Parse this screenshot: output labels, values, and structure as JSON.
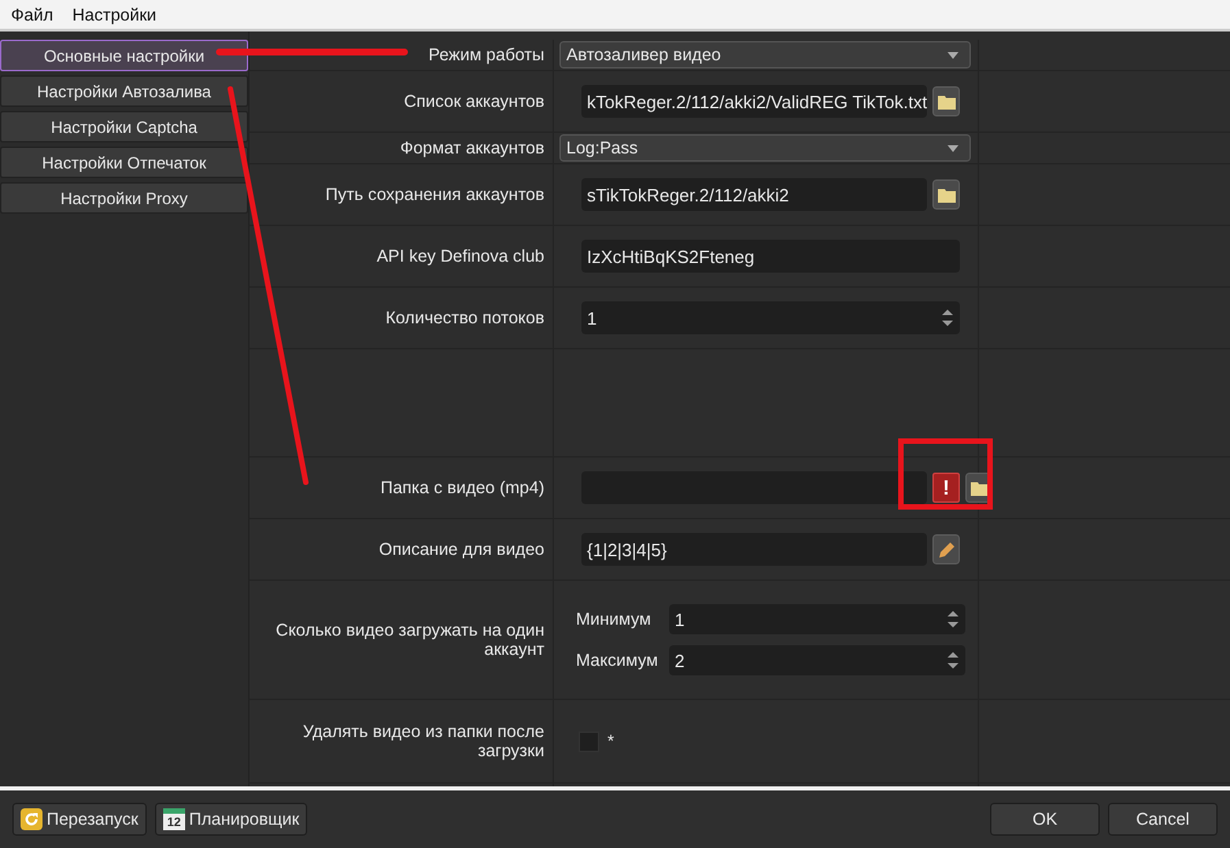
{
  "menu": [
    "Файл",
    "Настройки"
  ],
  "sidebar": {
    "items": [
      {
        "label": "Основные настройки",
        "selected": true
      },
      {
        "label": "Настройки Автозалива",
        "selected": false
      },
      {
        "label": "Настройки Captcha",
        "selected": false
      },
      {
        "label": "Настройки Отпечаток",
        "selected": false
      },
      {
        "label": "Настройки Proxy",
        "selected": false
      }
    ]
  },
  "form": {
    "rows": [
      {
        "kind": "combo",
        "label": "Режим работы",
        "value": "Автозаливер видео"
      },
      {
        "kind": "file",
        "label": "Список аккаунтов",
        "value": "kTokReger.2/112/akki2/ValidREG TikTok.txt"
      },
      {
        "kind": "combo",
        "label": "Формат аккаунтов",
        "value": "Log:Pass"
      },
      {
        "kind": "file",
        "label": "Путь сохранения аккаунтов",
        "value": "sTikTokReger.2/112/akki2"
      },
      {
        "kind": "text",
        "label": "API key Definova club",
        "value": "IzXcHtiBqKS2Fteneg"
      },
      {
        "kind": "spin",
        "label": "Количество потоков",
        "value": "1"
      },
      {
        "kind": "spacer"
      },
      {
        "kind": "file",
        "label": "Папка с видео (mp4)",
        "alert": "!"
      },
      {
        "kind": "edit",
        "label": "Описание для видео",
        "value": "{1|2|3|4|5}"
      },
      {
        "kind": "minmax",
        "label": "Сколько видео загружать на один аккаунт",
        "items": [
          {
            "label": "Минимум",
            "value": "1"
          },
          {
            "label": "Максимум",
            "value": "2"
          }
        ]
      },
      {
        "kind": "checkbox",
        "label": "Удалять видео из папки после загрузки",
        "checked": false,
        "text": "*"
      }
    ]
  },
  "footer": {
    "left_buttons": [
      {
        "kind": "restart",
        "label": "Перезапуск"
      },
      {
        "kind": "calendar",
        "label": "Планировщик",
        "icon_text": "12"
      }
    ],
    "right_buttons": [
      "OK",
      "Cancel"
    ]
  }
}
